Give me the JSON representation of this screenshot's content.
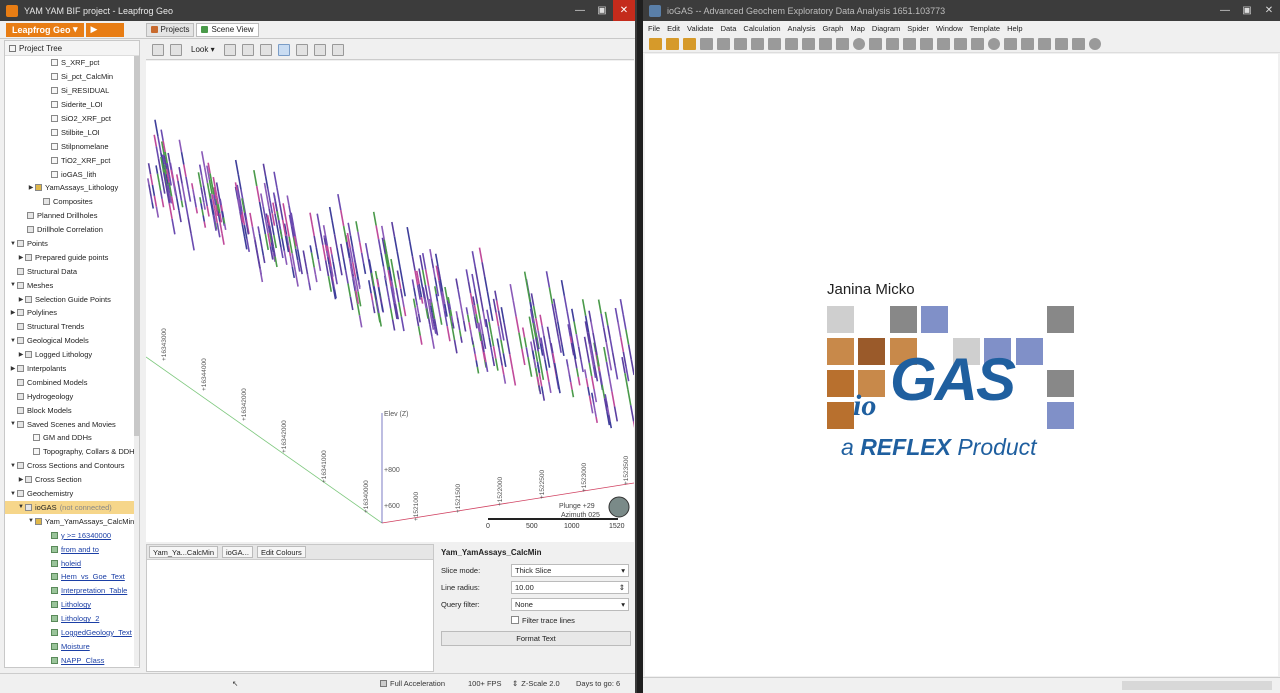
{
  "leapfrog": {
    "title": "YAM YAM BIF project - Leapfrog Geo",
    "brand": "Leapfrog Geo",
    "tabs": [
      "Projects",
      "Scene View"
    ],
    "project_tree_label": "Project Tree",
    "look_label": "Look",
    "tree": [
      {
        "label": "S_XRF_pct",
        "indent": 38,
        "arrow": "",
        "type": "col"
      },
      {
        "label": "Si_pct_CalcMin",
        "indent": 38,
        "arrow": "",
        "type": "col"
      },
      {
        "label": "Si_RESIDUAL",
        "indent": 38,
        "arrow": "",
        "type": "col"
      },
      {
        "label": "Siderite_LOI",
        "indent": 38,
        "arrow": "",
        "type": "col"
      },
      {
        "label": "SiO2_XRF_pct",
        "indent": 38,
        "arrow": "",
        "type": "col"
      },
      {
        "label": "Stilbite_LOI",
        "indent": 38,
        "arrow": "",
        "type": "col"
      },
      {
        "label": "Stilpnomelane",
        "indent": 38,
        "arrow": "",
        "type": "col"
      },
      {
        "label": "TiO2_XRF_pct",
        "indent": 38,
        "arrow": "",
        "type": "col"
      },
      {
        "label": "ioGAS_lith",
        "indent": 38,
        "arrow": "",
        "type": "col"
      },
      {
        "label": "YamAssays_Lithology",
        "indent": 22,
        "arrow": "▶",
        "type": "table"
      },
      {
        "label": "Composites",
        "indent": 30,
        "arrow": "",
        "type": "folder"
      },
      {
        "label": "Planned Drillholes",
        "indent": 14,
        "arrow": "",
        "type": "folder"
      },
      {
        "label": "Drillhole Correlation",
        "indent": 14,
        "arrow": "",
        "type": "folder"
      },
      {
        "label": "Points",
        "indent": 4,
        "arrow": "▼",
        "type": "folder"
      },
      {
        "label": "Prepared guide points",
        "indent": 12,
        "arrow": "▶",
        "type": "folder"
      },
      {
        "label": "Structural Data",
        "indent": 4,
        "arrow": "",
        "type": "folder"
      },
      {
        "label": "Meshes",
        "indent": 4,
        "arrow": "▼",
        "type": "folder"
      },
      {
        "label": "Selection Guide Points",
        "indent": 12,
        "arrow": "▶",
        "type": "folder"
      },
      {
        "label": "Polylines",
        "indent": 4,
        "arrow": "▶",
        "type": "folder"
      },
      {
        "label": "Structural Trends",
        "indent": 4,
        "arrow": "",
        "type": "folder"
      },
      {
        "label": "Geological Models",
        "indent": 4,
        "arrow": "▼",
        "type": "folder"
      },
      {
        "label": "Logged Lithology",
        "indent": 12,
        "arrow": "▶",
        "type": "folder"
      },
      {
        "label": "Interpolants",
        "indent": 4,
        "arrow": "▶",
        "type": "folder"
      },
      {
        "label": "Combined Models",
        "indent": 4,
        "arrow": "",
        "type": "folder"
      },
      {
        "label": "Hydrogeology",
        "indent": 4,
        "arrow": "",
        "type": "folder"
      },
      {
        "label": "Block Models",
        "indent": 4,
        "arrow": "",
        "type": "folder"
      },
      {
        "label": "Saved Scenes and Movies",
        "indent": 4,
        "arrow": "▼",
        "type": "folder"
      },
      {
        "label": "GM and DDHs",
        "indent": 20,
        "arrow": "",
        "type": "scene"
      },
      {
        "label": "Topography, Collars & DDH",
        "indent": 20,
        "arrow": "",
        "type": "scene"
      },
      {
        "label": "Cross Sections and Contours",
        "indent": 4,
        "arrow": "▼",
        "type": "folder"
      },
      {
        "label": "Cross Section",
        "indent": 12,
        "arrow": "▶",
        "type": "folder"
      },
      {
        "label": "Geochemistry",
        "indent": 4,
        "arrow": "▼",
        "type": "folder"
      },
      {
        "label": "ioGAS",
        "indent": 12,
        "arrow": "▼",
        "type": "folder",
        "note": "(not connected)",
        "highlight": true
      },
      {
        "label": "Yam_YamAssays_CalcMin",
        "indent": 22,
        "arrow": "▼",
        "type": "table"
      },
      {
        "label": "y >= 16340000",
        "indent": 38,
        "arrow": "",
        "type": "query",
        "link": true
      },
      {
        "label": "from and to",
        "indent": 38,
        "arrow": "",
        "type": "query",
        "link": true
      },
      {
        "label": "holeid",
        "indent": 38,
        "arrow": "",
        "type": "query",
        "link": true
      },
      {
        "label": "Hem_vs_Goe_Text",
        "indent": 38,
        "arrow": "",
        "type": "query",
        "link": true
      },
      {
        "label": "Interpretation_Table",
        "indent": 38,
        "arrow": "",
        "type": "query",
        "link": true
      },
      {
        "label": "Lithology",
        "indent": 38,
        "arrow": "",
        "type": "query",
        "link": true
      },
      {
        "label": "Lithology_2",
        "indent": 38,
        "arrow": "",
        "type": "query",
        "link": true
      },
      {
        "label": "LoggedGeology_Text",
        "indent": 38,
        "arrow": "",
        "type": "query",
        "link": true
      },
      {
        "label": "Moisture",
        "indent": 38,
        "arrow": "",
        "type": "query",
        "link": true
      },
      {
        "label": "NAPP_Class",
        "indent": 38,
        "arrow": "",
        "type": "query",
        "link": true
      }
    ],
    "scene": {
      "axis_elev": "Elev (Z)",
      "elev_ticks": [
        "+800",
        "+600"
      ],
      "y_ticks": [
        "+16343000",
        "+16344000",
        "+16342000",
        "+16342000",
        "+16341000",
        "+16340000"
      ],
      "x_ticks": [
        "+1521000",
        "+1521500",
        "+1522000",
        "+1522500",
        "+1523000",
        "+1523500"
      ],
      "plunge": "Plunge +29",
      "azimuth": "Azimuth 025",
      "scale_ticks": [
        "0",
        "500",
        "1000",
        "1520"
      ]
    },
    "bottom_tabs": [
      "Yam_Ya...CalcMin",
      "ioGA...",
      "Edit Colours"
    ],
    "properties": {
      "title": "Yam_YamAssays_CalcMin",
      "slice_mode_label": "Slice mode:",
      "slice_mode_value": "Thick Slice",
      "line_radius_label": "Line radius:",
      "line_radius_value": "10.00",
      "query_filter_label": "Query filter:",
      "query_filter_value": "None",
      "filter_trace_label": "Filter trace lines",
      "format_text_label": "Format Text"
    },
    "status": {
      "full_accel": "Full Acceleration",
      "fps": "100+ FPS",
      "zscale": "Z-Scale 2.0",
      "days": "Days to go: 6"
    }
  },
  "iogas": {
    "title": "ioGAS -- Advanced Geochem Exploratory Data Analysis 1651.103773",
    "menu": [
      "File",
      "Edit",
      "Validate",
      "Data",
      "Calculation",
      "Analysis",
      "Graph",
      "Map",
      "Diagram",
      "Spider",
      "Window",
      "Template",
      "Help"
    ],
    "author": "Janina Micko",
    "logo_io": "io",
    "logo_gas": "GAS",
    "tag_prefix": "a",
    "tag_brand": "REFLEX",
    "tag_suffix": "Product",
    "colors": {
      "blue": "#1f5f9f",
      "tan": "#c8894a",
      "brown": "#9a5a2a",
      "lavender": "#8090c8",
      "grey": "#888888",
      "lightgrey": "#cfcfcf"
    }
  }
}
